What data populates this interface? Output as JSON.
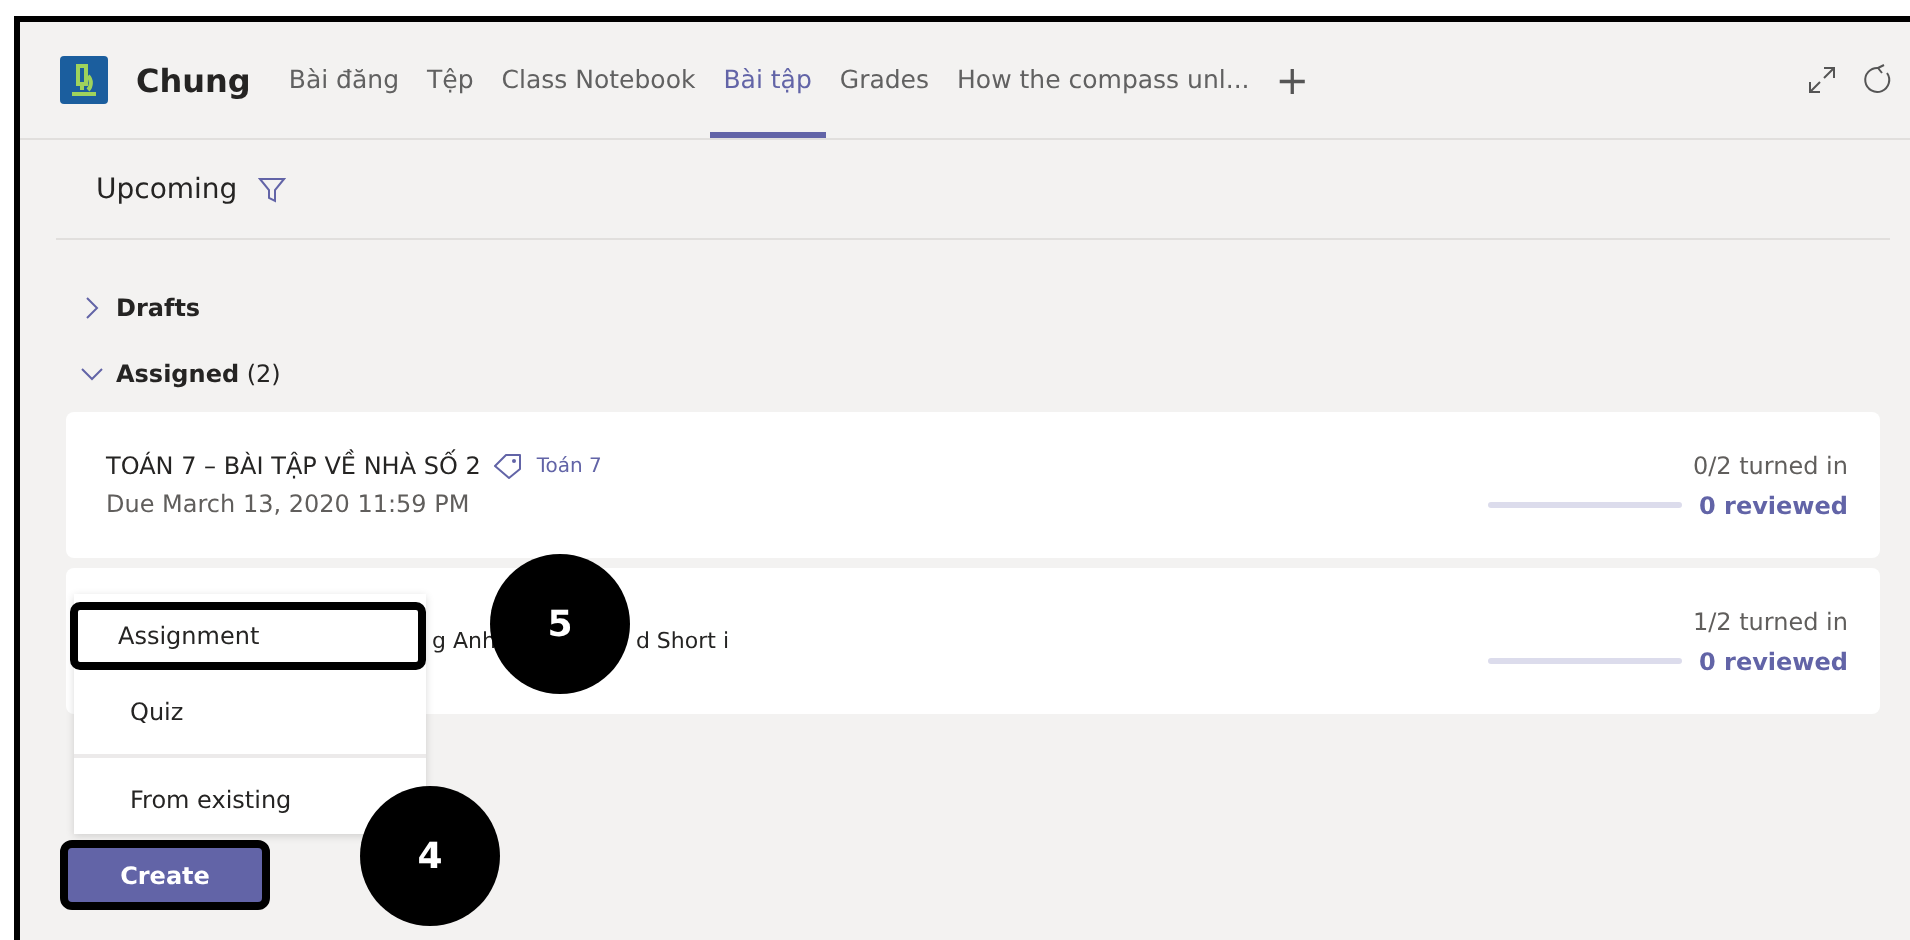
{
  "header": {
    "channel": "Chung",
    "tabs": [
      {
        "label": "Bài đăng",
        "selected": false
      },
      {
        "label": "Tệp",
        "selected": false
      },
      {
        "label": "Class Notebook",
        "selected": false
      },
      {
        "label": "Bài tập",
        "selected": true
      },
      {
        "label": "Grades",
        "selected": false
      },
      {
        "label": "How the compass unl...",
        "selected": false
      }
    ],
    "add_tab": "+"
  },
  "filter": {
    "label": "Upcoming"
  },
  "sections": [
    {
      "label": "Drafts",
      "expanded": false
    },
    {
      "label": "Assigned",
      "count": "(2)",
      "expanded": true
    }
  ],
  "assignments": [
    {
      "title": "TOÁN 7 – BÀI TẬP VỀ NHÀ SỐ 2",
      "tag": "Toán 7",
      "due": "Due March 13, 2020 11:59 PM",
      "turned_in": "0/2 turned in",
      "level": 0,
      "reviewed": "0 reviewed"
    },
    {
      "title_parts": [
        "g Anh",
        "d Short i"
      ],
      "turned_in": "1/2 turned in",
      "level": 0,
      "reviewed": "0 reviewed"
    }
  ],
  "create_menu": [
    {
      "label": "Assignment",
      "highlighted": true
    },
    {
      "label": "Quiz",
      "highlighted": false
    },
    {
      "label": "From existing",
      "highlighted": false
    }
  ],
  "create_button": {
    "label": "Create",
    "highlighted": true
  },
  "callouts": [
    {
      "label": "5"
    },
    {
      "label": "4"
    }
  ]
}
